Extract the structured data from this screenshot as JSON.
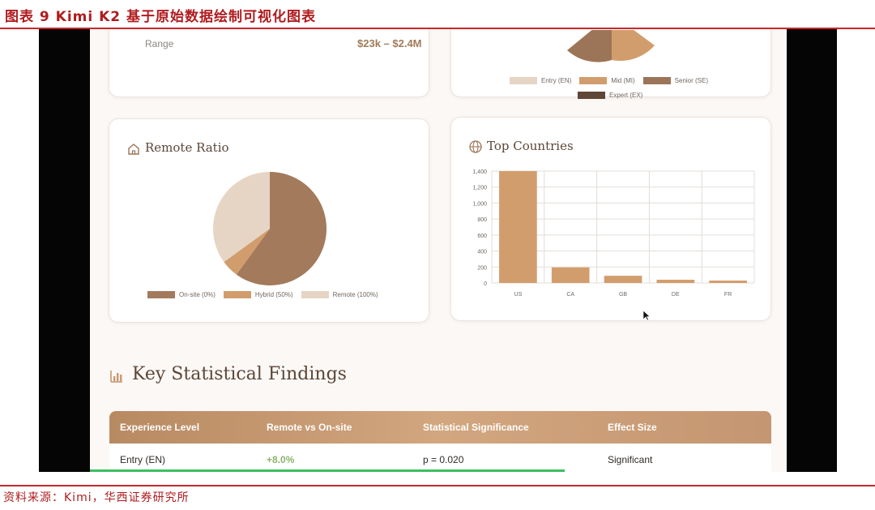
{
  "figure": {
    "title": "图表 9 Kimi K2 基于原始数据绘制可视化图表",
    "source": "资料来源：Kimi，华西证券研究所"
  },
  "salary_card": {
    "range_label": "Range",
    "range_value": "$23k – $2.4M"
  },
  "experience_card": {
    "legend": [
      {
        "label": "Entry (EN)",
        "color": "#e6d5c5"
      },
      {
        "label": "Mid (MI)",
        "color": "#d29d6c"
      },
      {
        "label": "Senior (SE)",
        "color": "#9c7558"
      },
      {
        "label": "Expert (EX)",
        "color": "#5f4637"
      }
    ]
  },
  "remote_card": {
    "title": "Remote Ratio",
    "icon": "home-icon"
  },
  "countries_card": {
    "title": "Top Countries",
    "icon": "globe-icon"
  },
  "section": {
    "title": "Key Statistical Findings",
    "icon": "bar-chart-icon"
  },
  "table": {
    "headers": [
      "Experience Level",
      "Remote vs On-site",
      "Statistical Significance",
      "Effect Size"
    ],
    "rows": [
      [
        "Entry (EN)",
        "+8.0%",
        "p = 0.020",
        "Significant"
      ]
    ]
  },
  "colors": {
    "accent": "#c9986e",
    "dark_brown": "#9c7558",
    "light": "#e6d5c5",
    "positive": "#8cb36c"
  },
  "chart_data": [
    {
      "type": "pie",
      "title": "Remote Ratio",
      "slices": [
        {
          "label": "On-site (0%)",
          "value": 60,
          "color": "#a37a5c"
        },
        {
          "label": "Hybrid (50%)",
          "value": 5,
          "color": "#d29d6c"
        },
        {
          "label": "Remote (100%)",
          "value": 35,
          "color": "#e6d5c5"
        }
      ],
      "legend": "bottom"
    },
    {
      "type": "bar",
      "title": "Top Countries",
      "categories": [
        "US",
        "CA",
        "GB",
        "DE",
        "FR"
      ],
      "values": [
        1400,
        195,
        90,
        40,
        30
      ],
      "ylim": [
        0,
        1400
      ],
      "yticks": [
        "1,400",
        "1,200",
        "1,000",
        "800",
        "600",
        "400",
        "200",
        "0"
      ],
      "grid": true,
      "color": "#d29d6c"
    }
  ]
}
